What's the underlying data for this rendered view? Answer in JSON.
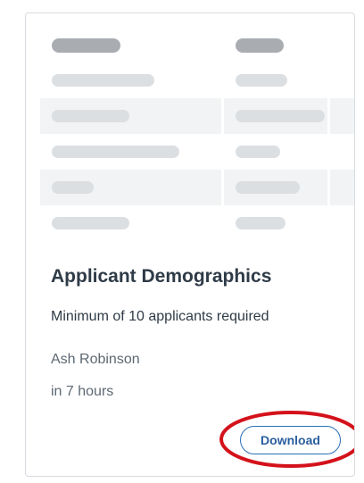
{
  "card": {
    "title": "Applicant Demographics",
    "subtitle": "Minimum of 10 applicants required",
    "owner": "Ash Robinson",
    "time": "in 7 hours",
    "download_label": "Download"
  },
  "preview": {
    "kind": "skeleton-table-placeholder",
    "rows": 6,
    "columns": 2
  },
  "colors": {
    "title_text": "#2f3b47",
    "muted_text": "#5d6873",
    "button_blue": "#2a5f9e",
    "button_border": "#2a6fb6",
    "card_border": "#d7dbe0",
    "highlight_red": "#d4121b",
    "skeleton_header": "#a9adb1",
    "skeleton_cell": "#dcdfe2",
    "stripe_bg": "#f2f3f4"
  }
}
